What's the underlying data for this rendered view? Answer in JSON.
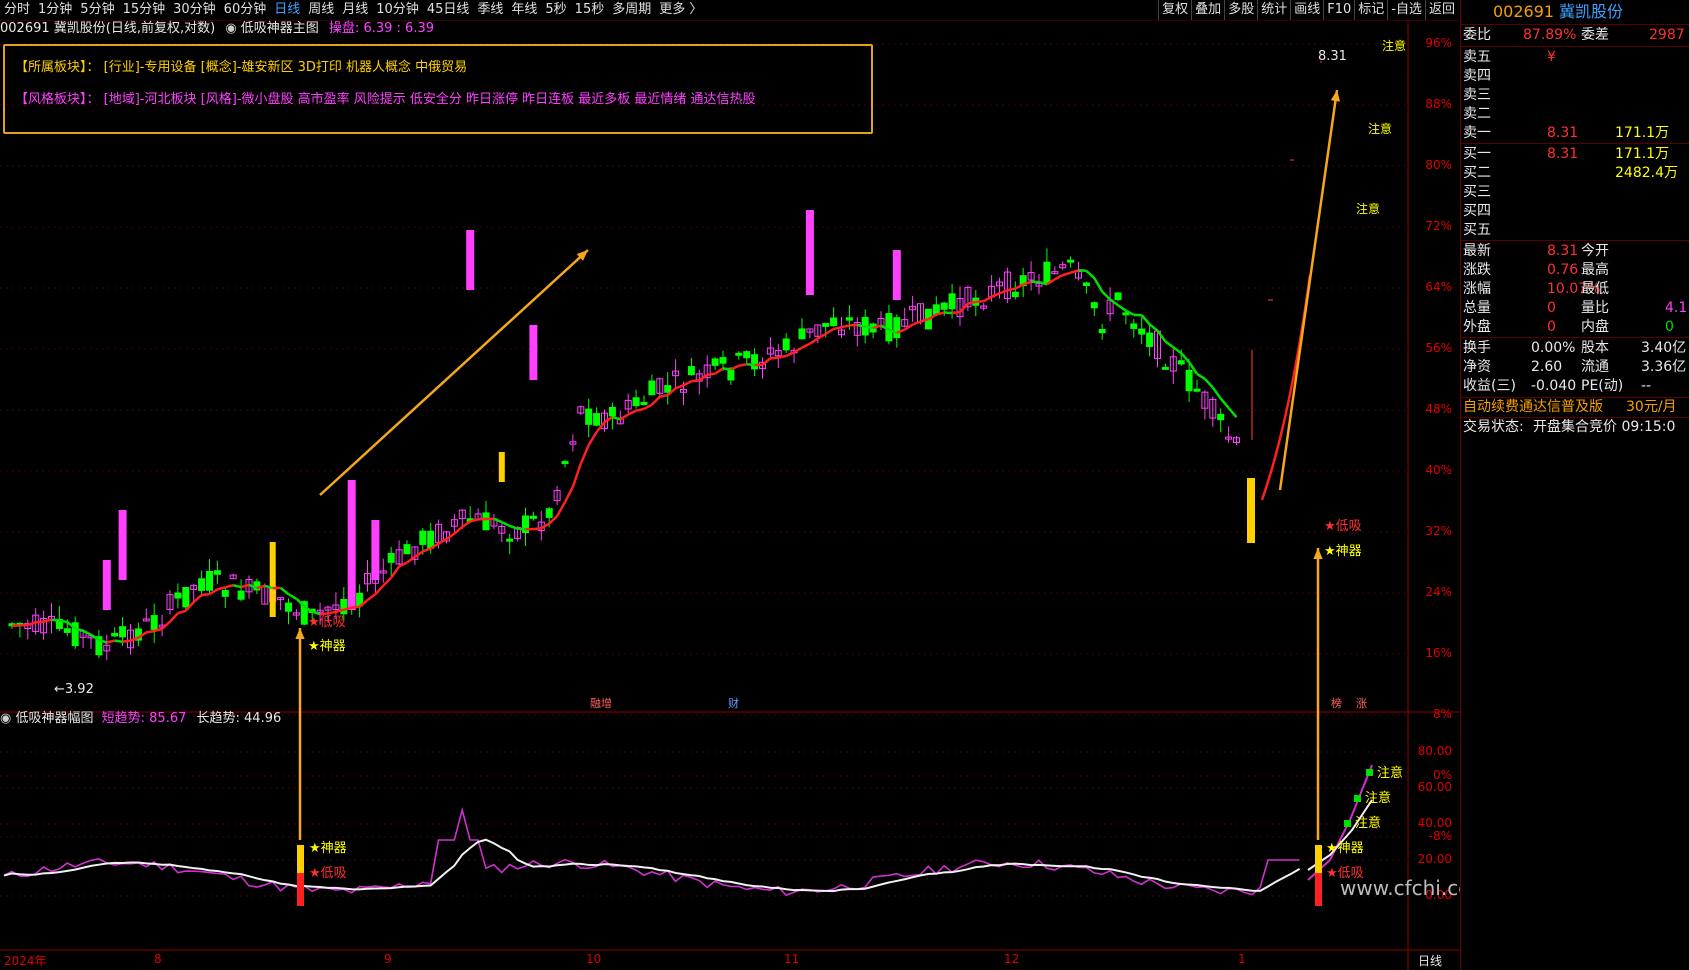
{
  "toolbar": {
    "periods": [
      "分时",
      "1分钟",
      "5分钟",
      "15分钟",
      "30分钟",
      "60分钟",
      "日线",
      "周线",
      "月线",
      "10分钟",
      "45日线",
      "季线",
      "年线",
      "5秒",
      "15秒",
      "多周期",
      "更多 〉"
    ],
    "active_period": "日线",
    "tools": [
      "复权",
      "叠加",
      "多股",
      "统计",
      "画线",
      "F10",
      "标记",
      "-自选",
      "返回"
    ]
  },
  "chart": {
    "stock_title": "002691 冀凯股份(日线,前复权,对数)",
    "indicator_name": "低吸神器主图",
    "indicator_value_label": "操盘: 6.39 : 6.39",
    "sector_line1_label": "【所属板块】：",
    "sector_line1_text": "[行业]-专用设备 [概念]-雄安新区 3D打印 机器人概念 中俄贸易",
    "sector_line2_label": "【风格板块】：",
    "sector_line2_text": "[地域]-河北板块 [风格]-微小盘股 高市盈率 风险提示 低安全分 昨日涨停 昨日连板 最近多板 最近情绪 通达信热股",
    "price_high_label": "8.31",
    "price_low_label": "←3.92",
    "y_axis": [
      "96%",
      "88%",
      "80%",
      "72%",
      "64%",
      "56%",
      "48%",
      "40%",
      "32%",
      "24%",
      "16%",
      "8%",
      "0%",
      "-8%"
    ],
    "signal_dixi": "★低吸",
    "signal_shenqi": "★神器",
    "signal_zhuyi": "注意",
    "event_markers": [
      "融增",
      "财",
      "榜",
      "涨"
    ],
    "colors": {
      "up": "#ff40ff",
      "down": "#00ff00",
      "ma_up": "#ff2020",
      "ma_down": "#00e000",
      "arrow": "#f5a81a",
      "panel_border": "#e3a21a"
    }
  },
  "sub_chart": {
    "name": "低吸神器幅图",
    "short_label": "短趋势: 85.67",
    "long_label": "长趋势: 44.96",
    "y_axis": [
      "80.00",
      "60.00",
      "40.00",
      "20.00",
      "0.00"
    ],
    "watermark": "www.cfchi.com"
  },
  "x_axis": {
    "dates": [
      "2024年",
      "8",
      "9",
      "10",
      "11",
      "12",
      "1"
    ],
    "period_label": "日线"
  },
  "right_panel": {
    "code": "002691",
    "name": "冀凯股份",
    "weibi_label": "委比",
    "weibi_value": "87.89%",
    "weicha_label": "委差",
    "weicha_value": "2987",
    "asks": [
      {
        "label": "卖五",
        "price": "¥",
        "vol": ""
      },
      {
        "label": "卖四",
        "price": "",
        "vol": ""
      },
      {
        "label": "卖三",
        "price": "",
        "vol": ""
      },
      {
        "label": "卖二",
        "price": "",
        "vol": ""
      },
      {
        "label": "卖一",
        "price": "8.31",
        "vol": "171.1万"
      }
    ],
    "bids": [
      {
        "label": "买一",
        "price": "8.31",
        "vol": "171.1万"
      },
      {
        "label": "买二",
        "price": "",
        "vol": "2482.4万"
      },
      {
        "label": "买三",
        "price": "",
        "vol": ""
      },
      {
        "label": "买四",
        "price": "",
        "vol": ""
      },
      {
        "label": "买五",
        "price": "",
        "vol": ""
      }
    ],
    "stats": [
      {
        "l1": "最新",
        "v1": "8.31",
        "l2": "今开",
        "v2": ""
      },
      {
        "l1": "涨跌",
        "v1": "0.76",
        "l2": "最高",
        "v2": ""
      },
      {
        "l1": "涨幅",
        "v1": "10.07%",
        "l2": "最低",
        "v2": ""
      },
      {
        "l1": "总量",
        "v1": "0",
        "l2": "量比",
        "v2": "4.1"
      },
      {
        "l1": "外盘",
        "v1": "0",
        "l2": "内盘",
        "v2": "0"
      }
    ],
    "stats2": [
      {
        "l1": "换手",
        "v1": "0.00%",
        "l2": "股本",
        "v2": "3.40亿"
      },
      {
        "l1": "净资",
        "v1": "2.60",
        "l2": "流通",
        "v2": "3.36亿"
      },
      {
        "l1": "收益(三)",
        "v1": "-0.040",
        "l2": "PE(动)",
        "v2": "--"
      }
    ],
    "ad_text": "自动续费通达信普及版",
    "ad_price": "30元/月",
    "trade_status_label": "交易状态:",
    "trade_status_value": "开盘集合竞价 09:15:0"
  }
}
